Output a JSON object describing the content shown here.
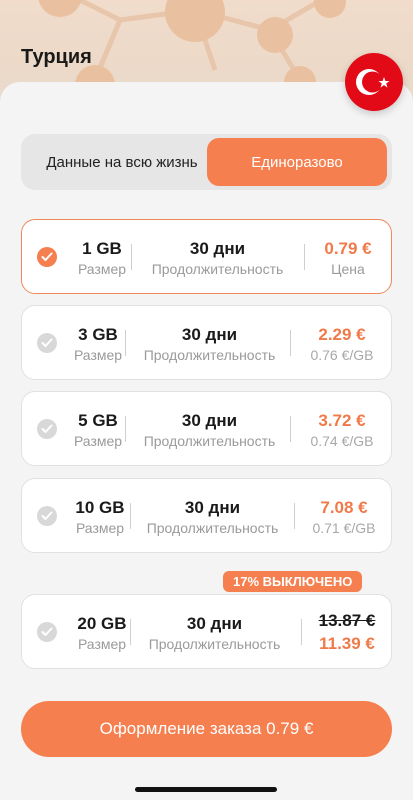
{
  "header": {
    "country": "Турция",
    "flag_icon": "turkey-flag-icon"
  },
  "segment": {
    "options": [
      "Данные на всю жизнь",
      "Единоразово"
    ],
    "selected_index": 1
  },
  "plans": [
    {
      "size": "1 GB",
      "size_label": "Размер",
      "duration": "30 дни",
      "duration_label": "Продолжительность",
      "price": "0.79 €",
      "price_sub": "Цена",
      "selected": true
    },
    {
      "size": "3 GB",
      "size_label": "Размер",
      "duration": "30 дни",
      "duration_label": "Продолжительность",
      "price": "2.29 €",
      "price_sub": "0.76 €/GB",
      "selected": false
    },
    {
      "size": "5 GB",
      "size_label": "Размер",
      "duration": "30 дни",
      "duration_label": "Продолжительность",
      "price": "3.72 €",
      "price_sub": "0.74 €/GB",
      "selected": false
    },
    {
      "size": "10 GB",
      "size_label": "Размер",
      "duration": "30 дни",
      "duration_label": "Продолжительность",
      "price": "7.08 €",
      "price_sub": "0.71 €/GB",
      "selected": false
    },
    {
      "size": "20 GB",
      "size_label": "Размер",
      "duration": "30 дни",
      "duration_label": "Продолжительность",
      "old_price": "13.87 €",
      "price": "11.39 €",
      "badge": "17% ВЫКЛЮЧЕНО",
      "selected": false
    }
  ],
  "footer": {
    "order_button": "Оформление заказа 0.79 €"
  },
  "colors": {
    "accent": "#f57f4f",
    "price": "#f07a49"
  }
}
